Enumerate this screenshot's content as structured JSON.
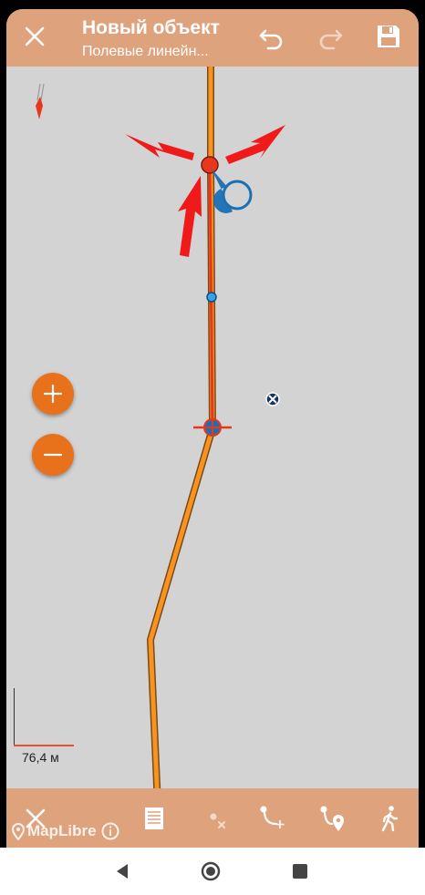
{
  "header": {
    "title": "Новый объект",
    "subtitle": "Полевые линейн..."
  },
  "map": {
    "scale_label": "76,4 м",
    "attribution": "MapLibre",
    "line_color": "#f7931e",
    "vertex_color": "#e8371b",
    "accent_blue": "#1a6fb5"
  },
  "icons": {
    "close": "close-icon",
    "undo": "undo-icon",
    "redo": "redo-icon",
    "save": "save-icon",
    "zoom_in": "plus-icon",
    "zoom_out": "minus-icon",
    "cancel": "close-icon",
    "attributes": "document-icon",
    "delete_point": "delete-point-icon",
    "add_point": "add-point-icon",
    "add_point_location": "location-point-icon",
    "walk": "walk-icon"
  },
  "colors": {
    "bar_background": "#dea27c",
    "map_background": "#d3d3d3",
    "zoom_button": "#e8711c"
  }
}
